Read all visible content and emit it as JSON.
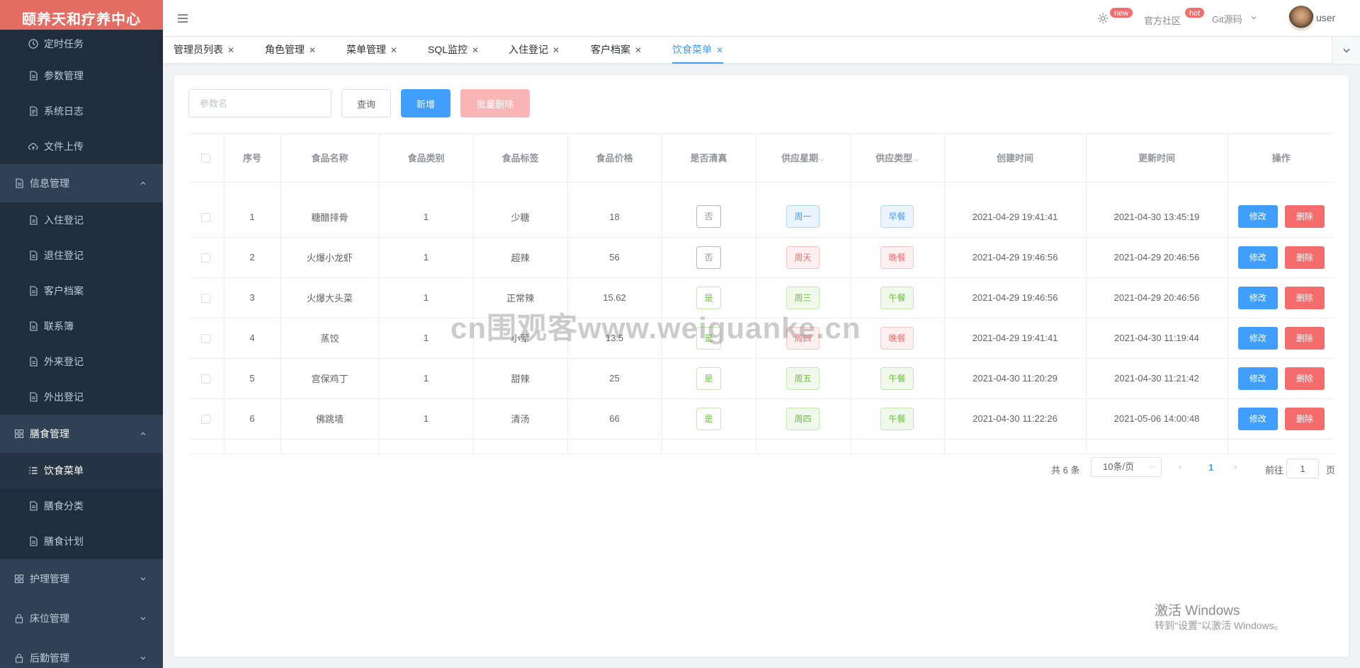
{
  "sidebar": {
    "logo": "颐养天和疗养中心",
    "items": [
      {
        "label": "定时任务",
        "icon": "clock-icon"
      },
      {
        "label": "参数管理",
        "icon": "document-icon"
      },
      {
        "label": "系统日志",
        "icon": "log-icon"
      },
      {
        "label": "文件上传",
        "icon": "cloud-upload-icon"
      },
      {
        "label": "信息管理",
        "icon": "document-icon"
      },
      {
        "label": "入住登记",
        "icon": "document-icon"
      },
      {
        "label": "退住登记",
        "icon": "document-icon"
      },
      {
        "label": "客户档案",
        "icon": "document-icon"
      },
      {
        "label": "联系簿",
        "icon": "document-icon"
      },
      {
        "label": "外来登记",
        "icon": "document-icon"
      },
      {
        "label": "外出登记",
        "icon": "document-icon"
      },
      {
        "label": "膳食管理",
        "icon": "grid-icon"
      },
      {
        "label": "饮食菜单",
        "icon": "list-icon"
      },
      {
        "label": "膳食分类",
        "icon": "document-icon"
      },
      {
        "label": "膳食计划",
        "icon": "document-icon"
      },
      {
        "label": "护理管理",
        "icon": "grid-icon"
      },
      {
        "label": "床位管理",
        "icon": "lock-icon"
      },
      {
        "label": "后勤管理",
        "icon": "lock-icon"
      }
    ]
  },
  "topbar": {
    "badge_new": "new",
    "community": "官方社区",
    "badge_hot": "hot",
    "git": "Git源码",
    "user": "user"
  },
  "tabs": [
    "管理员列表",
    "角色管理",
    "菜单管理",
    "SQL监控",
    "入住登记",
    "客户档案",
    "饮食菜单"
  ],
  "toolbar": {
    "search_placeholder": "参数名",
    "query": "查询",
    "add": "新增",
    "batch_delete": "批量删除"
  },
  "table": {
    "headers": [
      "序号",
      "食品名称",
      "食品类别",
      "食品标签",
      "食品价格",
      "是否清真",
      "供应星期",
      "供应类型",
      "创建时间",
      "更新时间",
      "操作"
    ],
    "edit_label": "修改",
    "delete_label": "删除",
    "rows": [
      {
        "id": "1",
        "name": "糖醋排骨",
        "category": "1",
        "tag": "少糖",
        "price": "18",
        "halal": "否",
        "weekday": "周一",
        "type": "早餐",
        "created": "2021-04-29 19:41:41",
        "updated": "2021-04-30 13:45:19"
      },
      {
        "id": "2",
        "name": "火爆小龙虾",
        "category": "1",
        "tag": "超辣",
        "price": "56",
        "halal": "否",
        "weekday": "周天",
        "type": "晚餐",
        "created": "2021-04-29 19:46:56",
        "updated": "2021-04-29 20:46:56"
      },
      {
        "id": "3",
        "name": "火爆大头菜",
        "category": "1",
        "tag": "正常辣",
        "price": "15.62",
        "halal": "是",
        "weekday": "周三",
        "type": "午餐",
        "created": "2021-04-29 19:46:56",
        "updated": "2021-04-29 20:46:56"
      },
      {
        "id": "4",
        "name": "蒸饺",
        "category": "1",
        "tag": "小荤",
        "price": "13.5",
        "halal": "是",
        "weekday": "周四",
        "type": "晚餐",
        "created": "2021-04-29 19:41:41",
        "updated": "2021-04-30 11:19:44"
      },
      {
        "id": "5",
        "name": "宫保鸡丁",
        "category": "1",
        "tag": "甜辣",
        "price": "25",
        "halal": "是",
        "weekday": "周五",
        "type": "午餐",
        "created": "2021-04-30 11:20:29",
        "updated": "2021-04-30 11:21:42"
      },
      {
        "id": "6",
        "name": "佛跳墙",
        "category": "1",
        "tag": "清汤",
        "price": "66",
        "halal": "是",
        "weekday": "周四",
        "type": "午餐",
        "created": "2021-04-30 11:22:26",
        "updated": "2021-05-06 14:00:48"
      }
    ]
  },
  "pagination": {
    "total": "共 6 条",
    "page_size": "10条/页",
    "current_page": "1",
    "goto_label": "前往",
    "goto_value": "1",
    "goto_suffix": "页"
  },
  "overlay": {
    "watermark": "cn围观客www.weiguanke.cn",
    "windows_title": "激活 Windows",
    "windows_sub": "转到\"设置\"以激活 Windows。"
  }
}
